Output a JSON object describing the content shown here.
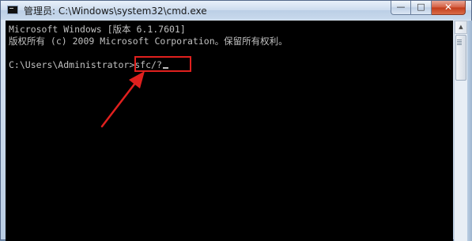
{
  "window": {
    "title": "管理员: C:\\Windows\\system32\\cmd.exe",
    "icon": "cmd-icon",
    "buttons": {
      "minimize": "—",
      "maximize": "□",
      "close": "✕"
    }
  },
  "console": {
    "lines": [
      "Microsoft Windows [版本 6.1.7601]",
      "版权所有 (c) 2009 Microsoft Corporation。保留所有权利。",
      "",
      "C:\\Users\\Administrator>sfc/?"
    ],
    "prompt": "C:\\Users\\Administrator>",
    "typed_command": "sfc/?"
  },
  "annotation": {
    "highlight_color": "#e0201e",
    "arrow_color": "#e0201e"
  },
  "scrollbar": {
    "up_arrow": "▲"
  }
}
